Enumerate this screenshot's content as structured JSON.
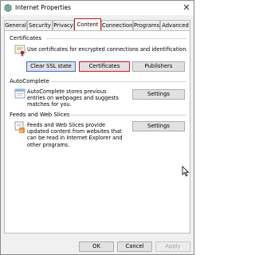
{
  "window": {
    "title": "Internet Properties",
    "close_glyph": "✕"
  },
  "tabs": [
    {
      "label": "General"
    },
    {
      "label": "Security"
    },
    {
      "label": "Privacy"
    },
    {
      "label": "Content"
    },
    {
      "label": "Connections"
    },
    {
      "label": "Programs"
    },
    {
      "label": "Advanced"
    }
  ],
  "active_tab": "Content",
  "certificates": {
    "heading": "Certificates",
    "description": "Use certificates for encrypted connections and identification.",
    "buttons": {
      "clear_ssl": "Clear SSL state",
      "certificates": "Certificates",
      "publishers": "Publishers"
    }
  },
  "autocomplete": {
    "heading": "AutoComplete",
    "description": "AutoComplete stores previous entries on webpages and suggests matches for you.",
    "settings_label": "Settings"
  },
  "feeds": {
    "heading": "Feeds and Web Slices",
    "description": "Feeds and Web Slices provide updated content from websites that can be read in Internet Explorer and other programs.",
    "settings_label": "Settings"
  },
  "footer": {
    "ok": "OK",
    "cancel": "Cancel",
    "apply": "Apply"
  },
  "colors": {
    "highlight_red": "#d8141b",
    "highlight_blue": "#2f6fd6"
  },
  "icons": [
    "ie-globe-icon",
    "certificate-icon",
    "autocomplete-icon",
    "feeds-icon",
    "mouse-cursor-icon"
  ]
}
